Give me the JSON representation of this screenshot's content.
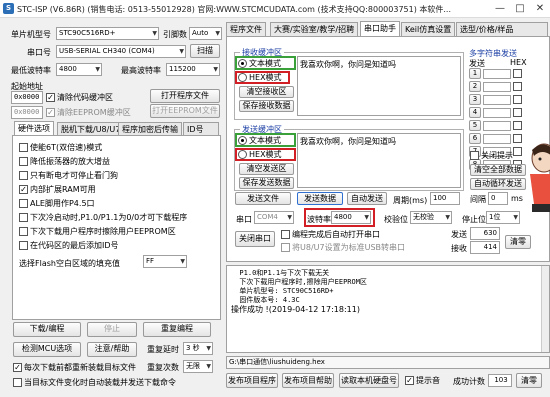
{
  "window": {
    "title": "STC-ISP (V6.86R) (销售电话: 0513-55012928) 官网:WWW.STCMCUDATA.com (技术支持QQ:800003751) 本软件...",
    "icon": "S",
    "controls": [
      "—",
      "□",
      "✕"
    ]
  },
  "left": {
    "mcu_label": "单片机型号",
    "mcu_value": "STC90C516RD+",
    "pin_label": "引脚数",
    "pin_value": "Auto",
    "port_label": "串口号",
    "port_value": "USB-SERIAL CH340 (COM4)",
    "scan_label": "扫描",
    "min_baud_label": "最低波特率",
    "min_baud_value": "4800",
    "max_baud_label": "最高波特率",
    "max_baud_value": "115200",
    "start_addr_label": "起始地址",
    "addr1": "0x0000",
    "clear_code_label": "清除代码缓冲区",
    "open_prog_label": "打开程序文件",
    "addr2": "0x0000",
    "clear_eeprom_label": "清除EEPROM缓冲区",
    "open_eeprom_label": "打开EEPROM文件",
    "tabs": [
      "硬件选项",
      "脱机下载/U8/U7",
      "程序加密后传输",
      "ID号"
    ],
    "options": [
      {
        "label": "使能6T(双倍速)模式",
        "checked": false
      },
      {
        "label": "降低振荡器的放大增益",
        "checked": false
      },
      {
        "label": "只有断电才可停止看门狗",
        "checked": false
      },
      {
        "label": "内部扩展RAM可用",
        "checked": true
      },
      {
        "label": "ALE脚用作P4.5口",
        "checked": false
      },
      {
        "label": "下次冷启动时,P1.0/P1.1为0/0才可下载程序",
        "checked": false
      },
      {
        "label": "下次下载用户程序时擦除用户EEPROM区",
        "checked": false
      },
      {
        "label": "在代码区的最后添加ID号",
        "checked": false
      }
    ],
    "flash_fill_label": "选择Flash空白区域的填充值",
    "flash_fill_value": "FF",
    "download_btn": "下载/编程",
    "stop_btn": "停止",
    "reprogram_btn": "重复编程",
    "detect_btn": "检测MCU选项",
    "help_btn": "注意/帮助",
    "repeat_delay_label": "重复延时",
    "repeat_delay_value": "3 秒",
    "repeat_count_label": "重复次数",
    "repeat_count_value": "无限",
    "reload_label": "每次下载前都重新装载目标文件",
    "auto_load_label": "当目标文件变化时自动装载并发送下载命令"
  },
  "right": {
    "tabs": [
      "程序文件",
      "大赛/实验室/教学/招聘",
      "串口助手",
      "Keil仿真设置",
      "选型/价格/样品"
    ],
    "recv": {
      "title": "接收缓冲区",
      "text_mode": "文本模式",
      "hex_mode": "HEX模式",
      "clear_btn": "清空接收区",
      "save_btn": "保存接收数据",
      "content": "我喜欢你啊，你问是知道吗"
    },
    "send": {
      "title": "发送缓冲区",
      "text_mode": "文本模式",
      "hex_mode": "HEX模式",
      "clear_btn": "清空发送区",
      "save_btn": "保存发送数据",
      "content": "我喜欢你啊，你问是知道吗"
    },
    "multi": {
      "title": "多字符串发送",
      "send_col": "发送",
      "hex_col": "HEX",
      "rows": [
        "1",
        "2",
        "3",
        "4",
        "5",
        "6",
        "7",
        "8"
      ],
      "close_hint": "关闭提示",
      "clear_all_btn": "清空全部数据",
      "auto_loop_btn": "自动循环发送",
      "interval_label": "间隔",
      "interval_value": "0",
      "interval_unit": "ms"
    },
    "send_file_btn": "发送文件",
    "send_data_btn": "发送数据",
    "auto_send_btn": "自动发送",
    "period_label": "周期(ms)",
    "period_value": "100",
    "port_label": "串口",
    "port_value": "COM4",
    "baud_label": "波特率",
    "baud_value": "4800",
    "parity_label": "校验位",
    "parity_value": "无校验",
    "stop_label": "停止位",
    "stop_value": "1位",
    "close_port_btn": "关闭串口",
    "opt1": "编程完成后自动打开串口",
    "opt2": "将U8/U7设置为标准USB转串口",
    "sent_label": "发送",
    "sent_value": "630",
    "recv_label": "接收",
    "recv_value": "414",
    "clear_btn": "清零"
  },
  "log": {
    "lines": [
      "  P1.0和P1.1与下次下载无关",
      "  下次下载用户程序时,擦除用户EEPROM区",
      "",
      "  单片机型号: STC90C516RD+",
      "  固件版本号: 4.3C",
      "",
      "",
      "操作成功 !(2019-04-12 17:18:11)"
    ]
  },
  "path": "G:\\串口通信\\liushuideng.hex",
  "bottom": {
    "publish_btn": "发布项目程序",
    "publish_help_btn": "发布项目帮助",
    "read_serial_btn": "读取本机硬盘号",
    "beep_label": "提示音",
    "success_label": "成功计数",
    "success_value": "103",
    "clear_btn": "清零"
  }
}
